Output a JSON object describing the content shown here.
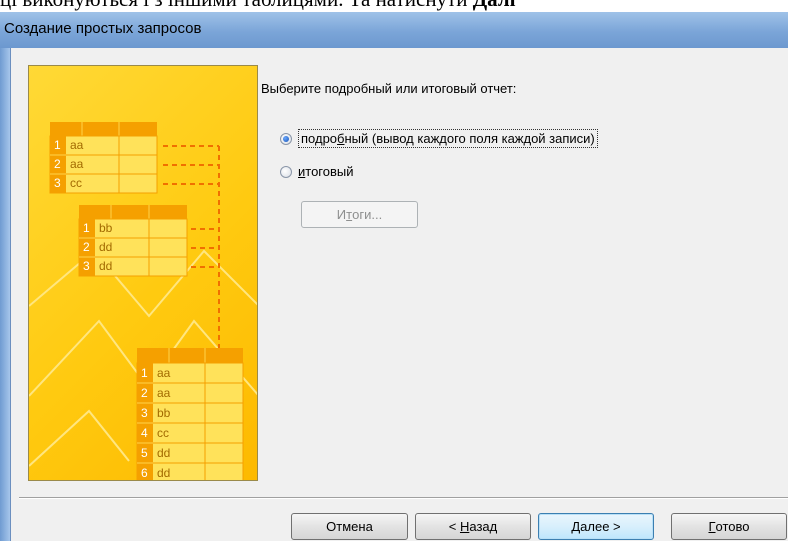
{
  "document": {
    "line_text": "ці виконуються і з іншими таблицями. Та натиснути ",
    "line_bold": "Далі"
  },
  "window": {
    "title": "Создание простых запросов"
  },
  "illustration": {
    "table1": {
      "numbers": [
        "1",
        "2",
        "3"
      ],
      "values": [
        "aa",
        "aa",
        "cc"
      ]
    },
    "table2": {
      "numbers": [
        "1",
        "2",
        "3"
      ],
      "values": [
        "bb",
        "dd",
        "dd"
      ]
    },
    "table3": {
      "numbers": [
        "1",
        "2",
        "3",
        "4",
        "5",
        "6"
      ],
      "values": [
        "aa",
        "aa",
        "bb",
        "cc",
        "dd",
        "dd"
      ]
    }
  },
  "prompt": "Выберите подробный или итоговый отчет:",
  "options": {
    "detail": {
      "pre": "подро",
      "key": "б",
      "post": "ный (вывод каждого поля каждой записи)",
      "selected": true
    },
    "summary": {
      "pre": "",
      "key": "и",
      "post": "тоговый",
      "selected": false
    }
  },
  "totals_button": {
    "pre": "И",
    "key": "т",
    "post": "оги...",
    "enabled": false
  },
  "buttons": {
    "cancel": {
      "label": "Отмена"
    },
    "back": {
      "pre": "< ",
      "key": "Н",
      "post": "азад"
    },
    "next": {
      "pre": "",
      "key": "Д",
      "post": "алее >"
    },
    "finish": {
      "pre": "",
      "key": "Г",
      "post": "отово"
    }
  },
  "colors": {
    "art_yellow": "#ffca10",
    "art_orange": "#f5a000",
    "title_bar": "#7ba5d8"
  }
}
